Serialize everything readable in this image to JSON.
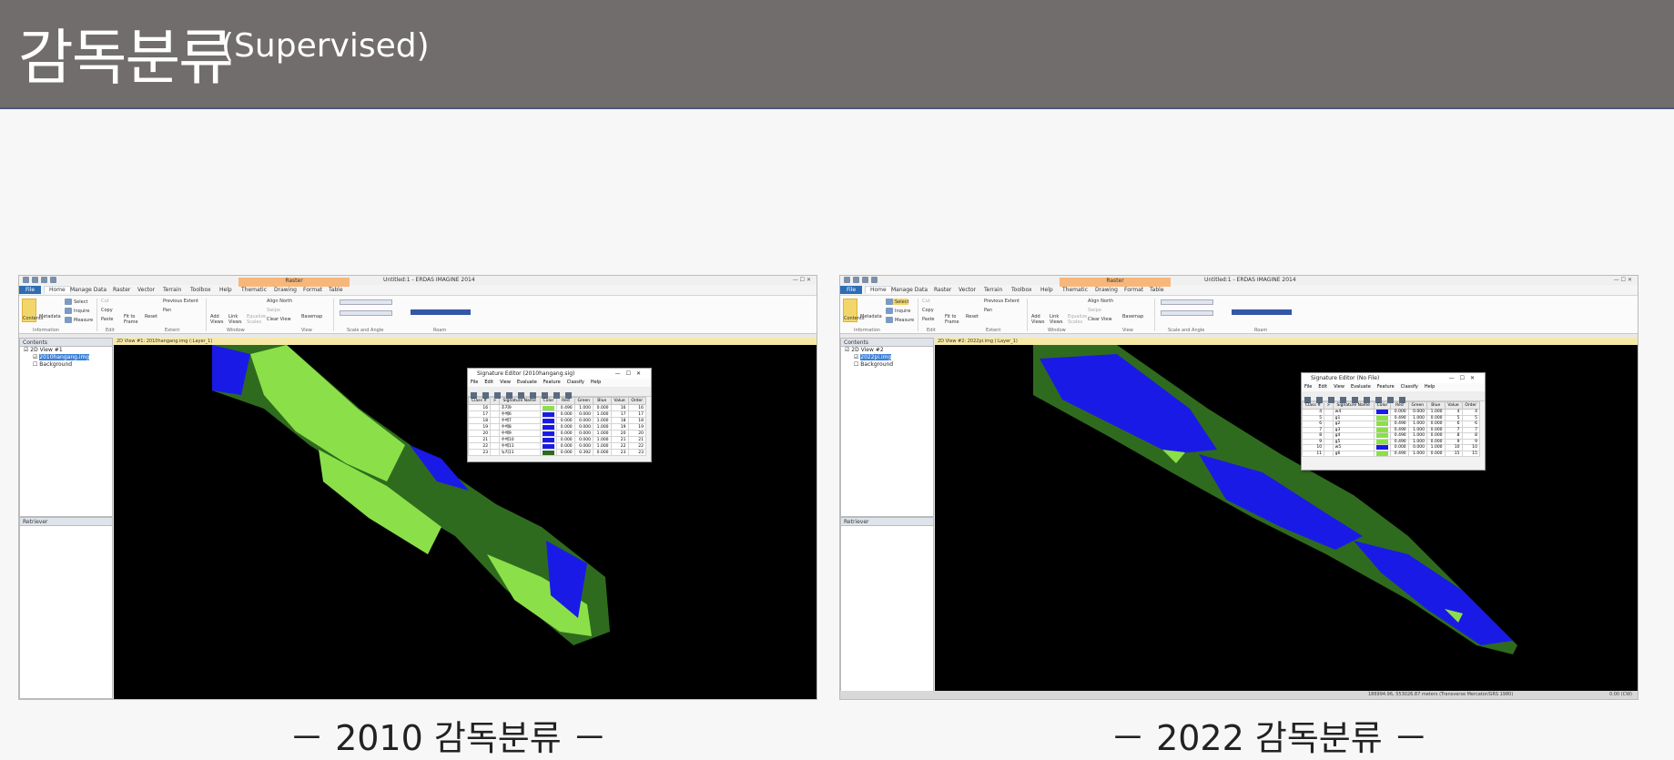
{
  "slide": {
    "title_main": "감독분류",
    "title_sub": "(Supervised)"
  },
  "app": {
    "window_title": "Untitled:1 - ERDAS IMAGINE 2014",
    "ribbon_tabs": [
      "File",
      "Home",
      "Manage Data",
      "Raster",
      "Vector",
      "Terrain",
      "Toolbox",
      "Help",
      "Thematic",
      "Drawing",
      "Format",
      "Table"
    ],
    "contextual_tab": "Raster",
    "ribbon_groups": [
      "Information",
      "Edit",
      "Extent",
      "Window",
      "View",
      "Scale and Angle",
      "Roam"
    ],
    "buttons": {
      "contents": "Contents",
      "metadata": "Metadata",
      "select": "Select",
      "inquire": "Inquire",
      "measure": "Measure",
      "cut": "Cut",
      "copy": "Copy",
      "paste": "Paste",
      "fit_to_frame": "Fit to Frame",
      "reset": "Reset",
      "previous_extent": "Previous Extent",
      "pan": "Pan",
      "add_views": "Add Views",
      "link_views": "Link Views",
      "equalize_scales": "Equalize Scales",
      "align_north": "Align North",
      "swipe": "Swipe",
      "clear_view": "Clear View",
      "basemap": "Basemap"
    },
    "panes": {
      "contents": "Contents",
      "retriever": "Retriever",
      "background": "Background"
    }
  },
  "left": {
    "view_tab": "2D View #1",
    "view_header": "2D View #1: 2010hangang.img (:Layer_1)",
    "layer_name": "2010hangang.img",
    "signature_title": "Signature Editor (2010hangang.sig)",
    "sig_menu": [
      "File",
      "Edit",
      "View",
      "Evaluate",
      "Feature",
      "Classify",
      "Help"
    ],
    "columns": [
      "Class #",
      ">",
      "Signature Name",
      "Color",
      "Red",
      "Green",
      "Blue",
      "Value",
      "Order"
    ],
    "rows": [
      {
        "cls": "16",
        "name": "초지9",
        "color": "#8be04a",
        "red": "0.490",
        "green": "1.000",
        "blue": "0.000",
        "value": "16",
        "order": "16"
      },
      {
        "cls": "17",
        "name": "수체6",
        "color": "#1a1ae6",
        "red": "0.000",
        "green": "0.000",
        "blue": "1.000",
        "value": "17",
        "order": "17"
      },
      {
        "cls": "18",
        "name": "수체7",
        "color": "#1a1ae6",
        "red": "0.000",
        "green": "0.000",
        "blue": "1.000",
        "value": "18",
        "order": "18"
      },
      {
        "cls": "19",
        "name": "수체8",
        "color": "#1a1ae6",
        "red": "0.000",
        "green": "0.000",
        "blue": "1.000",
        "value": "19",
        "order": "19"
      },
      {
        "cls": "20",
        "name": "수체9",
        "color": "#1a1ae6",
        "red": "0.000",
        "green": "0.000",
        "blue": "1.000",
        "value": "20",
        "order": "20"
      },
      {
        "cls": "21",
        "name": "수체10",
        "color": "#1a1ae6",
        "red": "0.000",
        "green": "0.000",
        "blue": "1.000",
        "value": "21",
        "order": "21"
      },
      {
        "cls": "22",
        "name": "수체11",
        "color": "#1a1ae6",
        "red": "0.000",
        "green": "0.000",
        "blue": "1.000",
        "value": "22",
        "order": "22"
      },
      {
        "cls": "23",
        "name": "녹지11",
        "color": "#2f6b1e",
        "red": "0.000",
        "green": "0.392",
        "blue": "0.000",
        "value": "23",
        "order": "23"
      }
    ],
    "caption": "－ 2010 감독분류 －"
  },
  "right": {
    "view_tab": "2D View #2",
    "view_header": "2D View #2: 2022pi.img (:Layer_1)",
    "layer_name": "2022pi.img",
    "signature_title": "Signature Editor (No File)",
    "sig_menu": [
      "File",
      "Edit",
      "View",
      "Evaluate",
      "Feature",
      "Classify",
      "Help"
    ],
    "columns": [
      "Class #",
      ">",
      "Signature Name",
      "Color",
      "Red",
      "Green",
      "Blue",
      "Value",
      "Order"
    ],
    "rows": [
      {
        "cls": "4",
        "name": "w4",
        "color": "#1a1ae6",
        "red": "0.000",
        "green": "0.000",
        "blue": "1.000",
        "value": "4",
        "order": "4"
      },
      {
        "cls": "5",
        "name": "g1",
        "color": "#8be04a",
        "red": "0.490",
        "green": "1.000",
        "blue": "0.000",
        "value": "5",
        "order": "5"
      },
      {
        "cls": "6",
        "name": "g2",
        "color": "#8be04a",
        "red": "0.490",
        "green": "1.000",
        "blue": "0.000",
        "value": "6",
        "order": "6"
      },
      {
        "cls": "7",
        "name": "g3",
        "color": "#8be04a",
        "red": "0.490",
        "green": "1.000",
        "blue": "0.000",
        "value": "7",
        "order": "7"
      },
      {
        "cls": "8",
        "name": "g4",
        "color": "#8be04a",
        "red": "0.490",
        "green": "1.000",
        "blue": "0.000",
        "value": "8",
        "order": "8"
      },
      {
        "cls": "9",
        "name": "g5",
        "color": "#8be04a",
        "red": "0.490",
        "green": "1.000",
        "blue": "0.000",
        "value": "9",
        "order": "9"
      },
      {
        "cls": "10",
        "name": "w5",
        "color": "#1a1ae6",
        "red": "0.000",
        "green": "0.000",
        "blue": "1.000",
        "value": "10",
        "order": "10"
      },
      {
        "cls": "11",
        "name": "g6",
        "color": "#8be04a",
        "red": "0.490",
        "green": "1.000",
        "blue": "0.000",
        "value": "15",
        "order": "15"
      }
    ],
    "status": "186994.96, 553026.87 meters (Transverse Mercator/GRS 1980)",
    "status_angle": "0.00 (CW)",
    "caption": "－ 2022 감독분류 －"
  },
  "colors": {
    "water_blue": "#1a1ae6",
    "grass_lightgreen": "#8be04a",
    "forest_darkgreen": "#2f6b1e",
    "title_bg": "#706d6c"
  }
}
